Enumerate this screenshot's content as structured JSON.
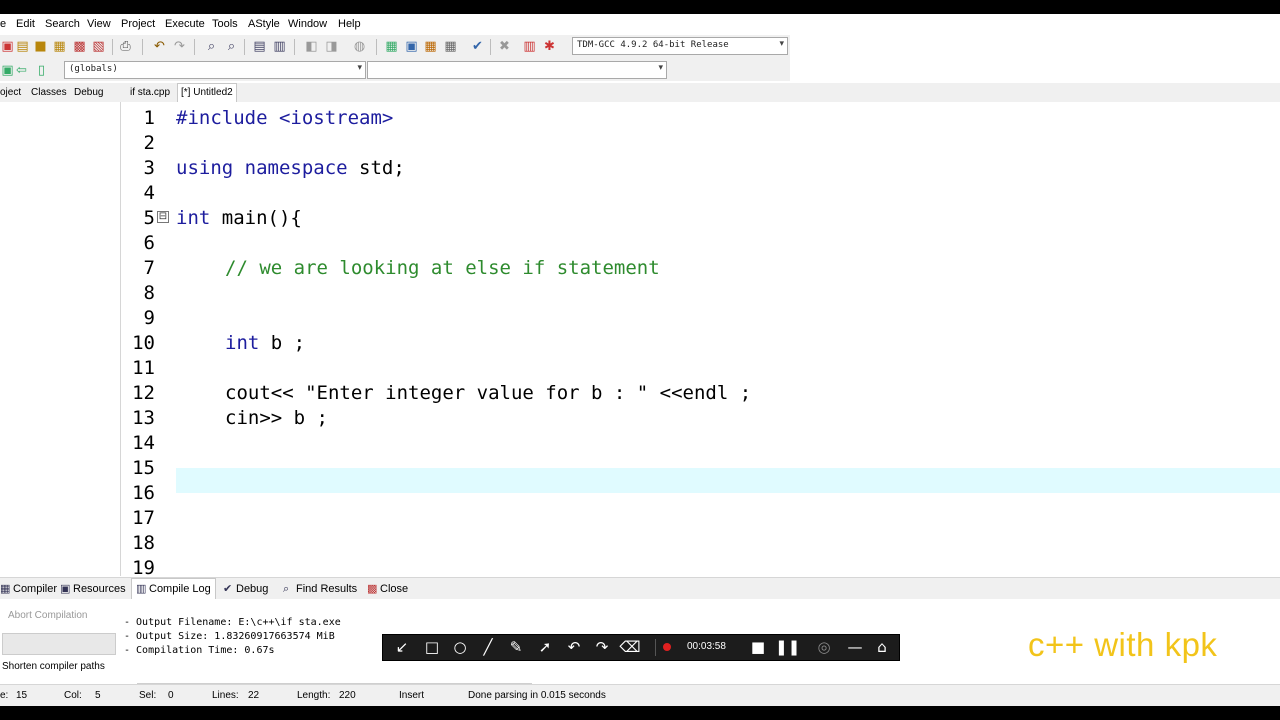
{
  "menu": [
    "e",
    "Edit",
    "Search",
    "View",
    "Project",
    "Execute",
    "Tools",
    "AStyle",
    "Window",
    "Help"
  ],
  "toolbar": {
    "compiler_select": "TDM-GCC 4.9.2 64-bit Release",
    "scope_select": "(globals)",
    "symbol_select": ""
  },
  "left_tabs": [
    "oject",
    "Classes",
    "Debug"
  ],
  "file_tabs": [
    "if sta.cpp",
    "[*] Untitled2"
  ],
  "editor": {
    "line_numbers": [
      "1",
      "2",
      "3",
      "4",
      "5",
      "6",
      "7",
      "8",
      "9",
      "10",
      "11",
      "12",
      "13",
      "14",
      "15",
      "16",
      "17",
      "18",
      "19"
    ],
    "lines": {
      "l1_pp": "#include <iostream>",
      "l3_kw": "using namespace",
      "l3_rest": " std;",
      "l5_kw": "int",
      "l5_rest": " main(){",
      "l7_cm": "// we are looking at else if statement",
      "l10_kw": "int",
      "l10_rest": " b ;",
      "l12": "cout<< \"Enter integer value for b : \" <<endl ;",
      "l13": "cin>> b ;"
    },
    "fold_marker": "⊟"
  },
  "bottom_tabs": [
    "Compiler",
    "Resources",
    "Compile Log",
    "Debug",
    "Find Results",
    "Close"
  ],
  "compile_panel": {
    "abort_label": "Abort Compilation",
    "shorten_label": "Shorten compiler paths",
    "log": [
      "- Output Filename: E:\\c++\\if sta.exe",
      "- Output Size: 1.83260917663574 MiB",
      "- Compilation Time: 0.67s"
    ]
  },
  "status": {
    "line_label": "e:",
    "line_value": "15",
    "col_label": "Col:",
    "col_value": "5",
    "sel_label": "Sel:",
    "sel_value": "0",
    "lines_label": "Lines:",
    "lines_value": "22",
    "length_label": "Length:",
    "length_value": "220",
    "mode": "Insert",
    "message": "Done parsing in 0.015 seconds"
  },
  "recorder": {
    "time": "00:03:58"
  },
  "watermark": "c++ with kpk"
}
